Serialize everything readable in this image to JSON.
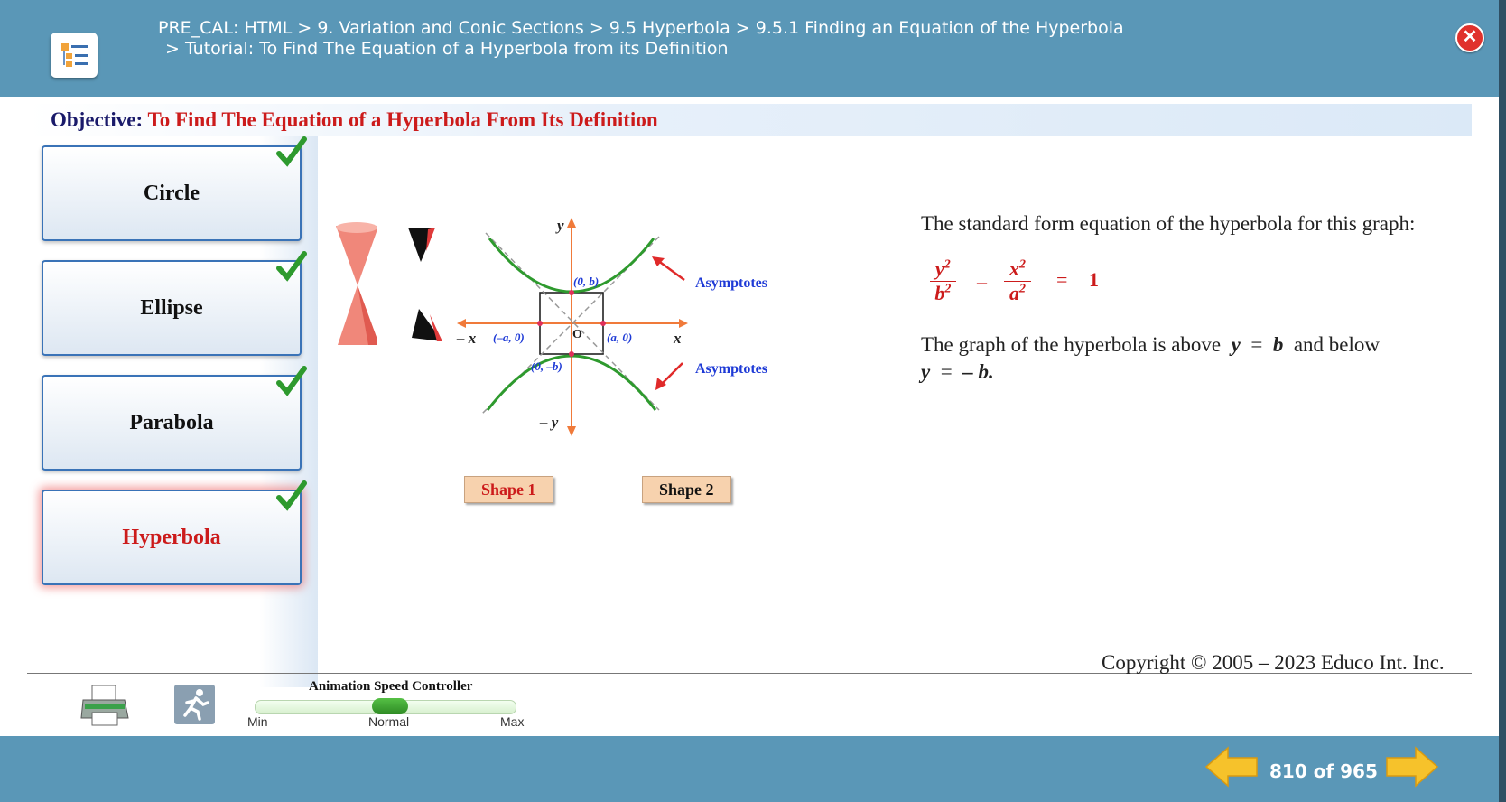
{
  "header": {
    "breadcrumb_line1": "PRE_CAL: HTML > 9. Variation and Conic Sections > 9.5 Hyperbola > 9.5.1 Finding an Equation of the Hyperbola",
    "breadcrumb_line2": "> Tutorial: To Find The Equation of a Hyperbola from its Definition",
    "close_symbol": "✕"
  },
  "objective": {
    "label": "Objective:",
    "text": " To Find The Equation of a Hyperbola From Its Definition"
  },
  "sidebar": {
    "items": [
      {
        "label": "Circle",
        "completed": true
      },
      {
        "label": "Ellipse",
        "completed": true
      },
      {
        "label": "Parabola",
        "completed": true
      },
      {
        "label": "Hyperbola",
        "completed": true,
        "active": true
      }
    ]
  },
  "diagram": {
    "y_label": "y",
    "neg_y_label": "– y",
    "x_label": "x",
    "neg_x_label": "– x",
    "origin_label": "O",
    "pt_top": "(0, b)",
    "pt_bottom": "(0, –b)",
    "pt_left": "(–a, 0)",
    "pt_right": "(a, 0)",
    "asymptotes_label_1": "Asymptotes",
    "asymptotes_label_2": "Asymptotes",
    "shape1_label": "Shape 1",
    "shape2_label": "Shape 2"
  },
  "explanation": {
    "intro": "The standard form equation of the hyperbola for this graph:",
    "eq_num1": "y",
    "eq_den1": "b",
    "eq_num2": "x",
    "eq_den2": "a",
    "eq_exp": "2",
    "eq_minus": "–",
    "eq_equals": "=",
    "eq_rhs": "1",
    "graph_text_1": "The graph of the hyperbola is above",
    "graph_y1": "y",
    "graph_eq1": "=",
    "graph_b1": "b",
    "graph_text_2": "and below",
    "graph_y2": "y",
    "graph_eq2": "=",
    "graph_b2": "– b."
  },
  "footer": {
    "speed_title": "Animation Speed Controller",
    "speed_min": "Min",
    "speed_normal": "Normal",
    "speed_max": "Max",
    "speed_level": 0.5,
    "copyright": "Copyright © 2005 – 2023 Educo Int. Inc."
  },
  "pager": {
    "current": "810",
    "of_label": "of",
    "total": "965"
  },
  "colors": {
    "header_bg": "#5a97b7",
    "accent_red": "#cc1b1b",
    "check_green": "#2e9a2e",
    "axis_orange": "#f07a3a",
    "curve_green": "#2e9a2e",
    "label_blue": "#1e3ad6"
  }
}
